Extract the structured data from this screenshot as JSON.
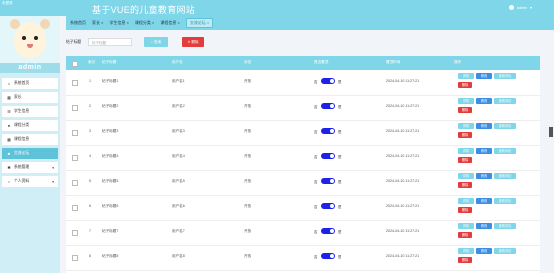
{
  "topbar": {
    "badge": "未登录",
    "title": "基于VUE的儿童教育网站",
    "user": "admin"
  },
  "tabs": [
    "系统首页",
    "家长",
    "学生信息",
    "课程分类",
    "课程信息",
    "交流论坛"
  ],
  "sidebar": {
    "username": "admin",
    "items": [
      {
        "label": "系统首页",
        "icon": "home-icon"
      },
      {
        "label": "家长",
        "icon": "grid-icon"
      },
      {
        "label": "学生信息",
        "icon": "list-icon"
      },
      {
        "label": "课程分类",
        "icon": "person-icon"
      },
      {
        "label": "课程信息",
        "icon": "grid-icon"
      },
      {
        "label": "交流论坛",
        "icon": "chat-icon",
        "active": true
      },
      {
        "label": "系统管理",
        "icon": "gear-icon",
        "expandable": true
      },
      {
        "label": "个人资料",
        "icon": "user-icon",
        "expandable": true
      }
    ]
  },
  "search": {
    "label": "帖子标题",
    "placeholder": "帖子标题",
    "button": "查询",
    "delete_button": "删除"
  },
  "table": {
    "headers": [
      "索引",
      "帖子标题",
      "用户名",
      "状态",
      "是否置顶",
      "置顶时间",
      "操作"
    ],
    "switch_off": "否",
    "switch_on": "是",
    "actions": {
      "view": "详情",
      "edit": "修改",
      "review": "查看评论",
      "delete": "删除"
    },
    "rows": [
      {
        "index": "1",
        "title": "帖子标题1",
        "user": "用户名1",
        "status": "开放",
        "time": "2024-04-10 11:27:21"
      },
      {
        "index": "2",
        "title": "帖子标题2",
        "user": "用户名2",
        "status": "开放",
        "time": "2024-04-10 11:27:21"
      },
      {
        "index": "3",
        "title": "帖子标题3",
        "user": "用户名3",
        "status": "开放",
        "time": "2024-04-10 11:27:21"
      },
      {
        "index": "4",
        "title": "帖子标题4",
        "user": "用户名4",
        "status": "开放",
        "time": "2024-04-10 11:27:21"
      },
      {
        "index": "5",
        "title": "帖子标题5",
        "user": "用户名5",
        "status": "开放",
        "time": "2024-04-10 11:27:21"
      },
      {
        "index": "6",
        "title": "帖子标题6",
        "user": "用户名6",
        "status": "开放",
        "time": "2024-04-10 11:27:21"
      },
      {
        "index": "7",
        "title": "帖子标题7",
        "user": "用户名7",
        "status": "开放",
        "time": "2024-04-10 11:27:21"
      },
      {
        "index": "8",
        "title": "帖子标题8",
        "user": "用户名8",
        "status": "开放",
        "time": "2024-04-10 11:27:21"
      }
    ]
  },
  "colors": {
    "accent": "#7fd6e8",
    "danger": "#e23c3c",
    "primary": "#3a8ee6",
    "switch": "#1c22e8"
  }
}
